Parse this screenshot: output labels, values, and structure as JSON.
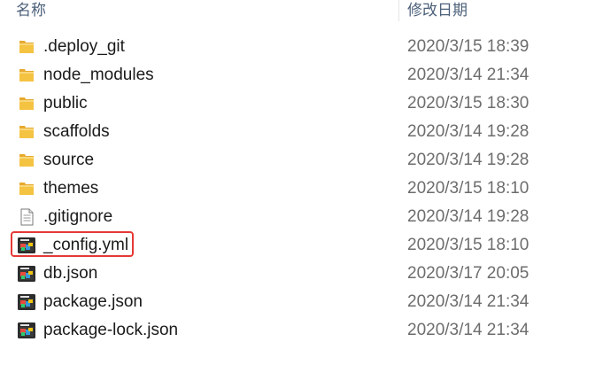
{
  "header": {
    "name_label": "名称",
    "date_label": "修改日期"
  },
  "files": [
    {
      "name": ".deploy_git",
      "date": "2020/3/15 18:39",
      "type": "folder"
    },
    {
      "name": "node_modules",
      "date": "2020/3/14 21:34",
      "type": "folder"
    },
    {
      "name": "public",
      "date": "2020/3/15 18:30",
      "type": "folder"
    },
    {
      "name": "scaffolds",
      "date": "2020/3/14 19:28",
      "type": "folder"
    },
    {
      "name": "source",
      "date": "2020/3/14 19:28",
      "type": "folder"
    },
    {
      "name": "themes",
      "date": "2020/3/15 18:10",
      "type": "folder"
    },
    {
      "name": ".gitignore",
      "date": "2020/3/14 19:28",
      "type": "text-file"
    },
    {
      "name": "_config.yml",
      "date": "2020/3/15 18:10",
      "type": "app-file",
      "highlighted": true
    },
    {
      "name": "db.json",
      "date": "2020/3/17 20:05",
      "type": "app-file"
    },
    {
      "name": "package.json",
      "date": "2020/3/14 21:34",
      "type": "app-file"
    },
    {
      "name": "package-lock.json",
      "date": "2020/3/14 21:34",
      "type": "app-file"
    }
  ],
  "colors": {
    "folder": "#f5c342",
    "highlight": "#e53935"
  }
}
